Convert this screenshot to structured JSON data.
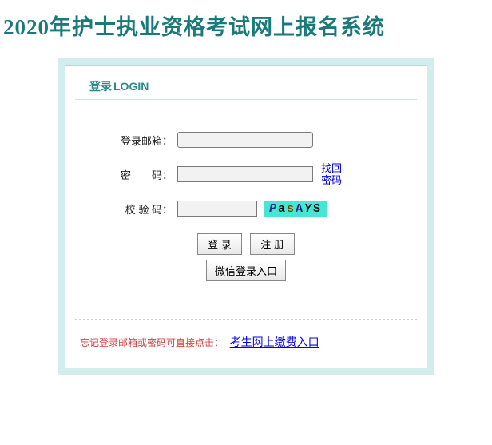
{
  "page": {
    "title": "2020年护士执业资格考试网上报名系统"
  },
  "login": {
    "header_cn": "登录",
    "header_en": "LOGIN",
    "email_label": "登录邮箱：",
    "password_label": "密　　码：",
    "captcha_label": "校 验 码：",
    "forgot_label": "找回密码",
    "captcha_value": "PasAYS",
    "login_button": "登 录",
    "register_button": "注 册",
    "wechat_button": "微信登录入口"
  },
  "footer": {
    "hint": "忘记登录邮箱或密码可直接点击：",
    "payment_link": "考生网上缴费入口"
  }
}
